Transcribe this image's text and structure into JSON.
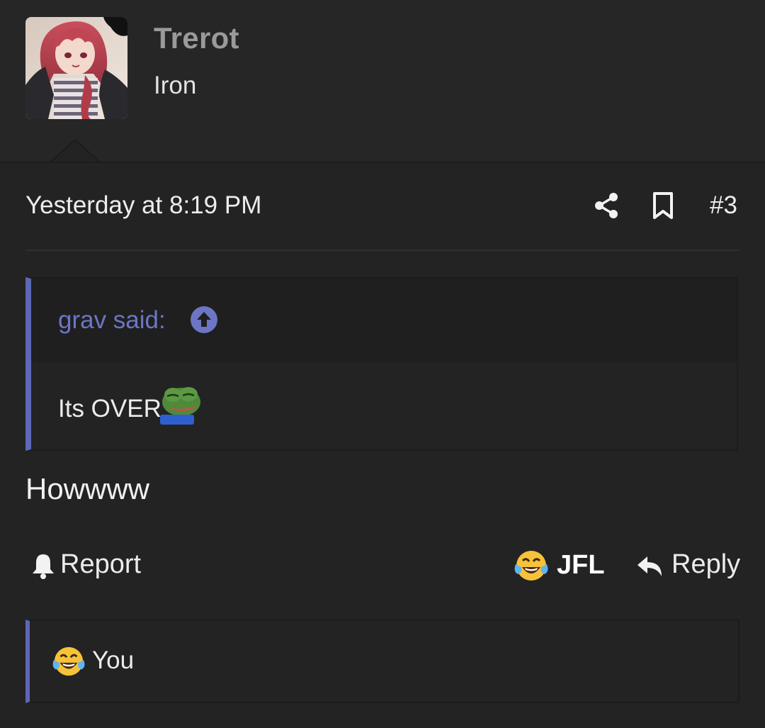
{
  "header": {
    "username": "Trerot",
    "user_title": "Iron",
    "avatar_icon": "anime-avatar"
  },
  "meta": {
    "timestamp": "Yesterday at 8:19 PM",
    "post_number": "#3"
  },
  "quote": {
    "author": "grav said:",
    "text": "Its OVER",
    "emoji": "pepe-sad-icon",
    "accent_color": "#5d67b6"
  },
  "post": {
    "body": "Howwww"
  },
  "actions": {
    "report_label": "Report",
    "reaction_label": "JFL",
    "reply_label": "Reply"
  },
  "reactions": {
    "summary_label": "You",
    "emoji": "crying-laughing-emoji"
  },
  "colors": {
    "background": "#232323",
    "header_background": "#262626",
    "username": "#9a9a9a",
    "accent": "#5d67b6"
  }
}
